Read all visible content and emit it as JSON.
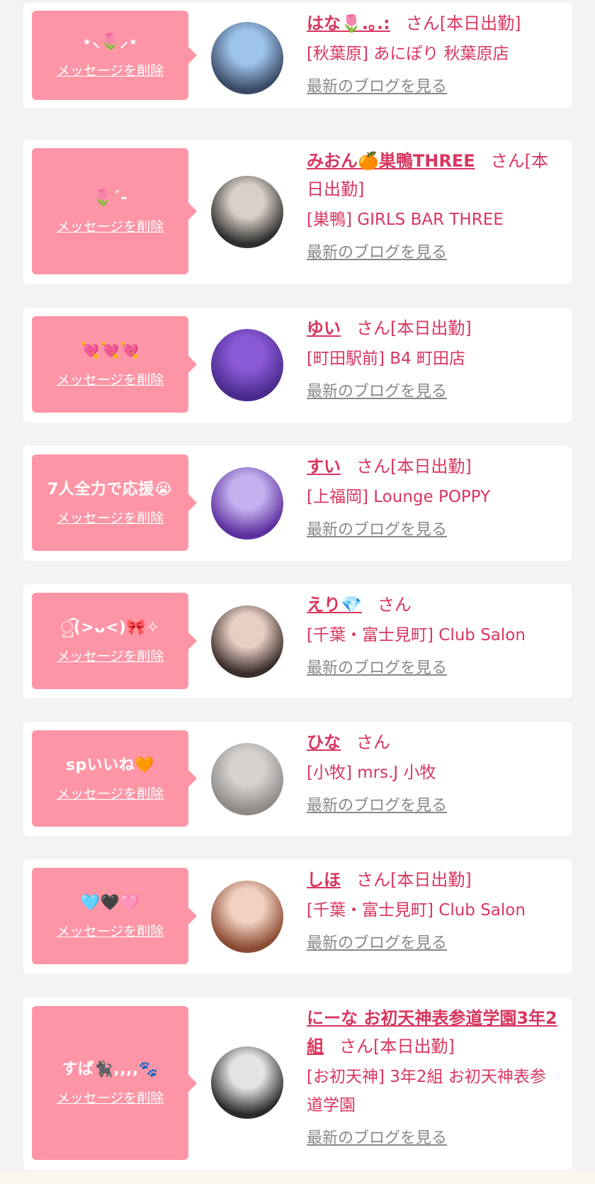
{
  "delete_label": "メッセージを削除",
  "blog_label": "最新のブログを見る",
  "san": "さん",
  "cards": [
    {
      "message": "⋆⸜🌷⸝⋆",
      "name": "はな🌷.｡.:",
      "status": "[本日出勤]",
      "shop": "[秋葉原] あにぽり 秋葉原店",
      "avatar_colors": [
        "#3a4a66",
        "#9ec4ec"
      ]
    },
    {
      "message": "🌷´-",
      "name": "みおん🍊巣鴨THREE",
      "status": "[本日出勤]",
      "shop": "[巣鴨] GIRLS BAR THREE",
      "avatar_colors": [
        "#2e2e2e",
        "#d9d1c7"
      ]
    },
    {
      "message": "💘💘💘",
      "name": "ゆい",
      "status": "[本日出勤]",
      "shop": "[町田駅前] B4 町田店",
      "avatar_colors": [
        "#4a2a8c",
        "#8a5ad6"
      ]
    },
    {
      "message": "7人全力で応援😭",
      "name": "すい",
      "status": "[本日出勤]",
      "shop": "[上福岡] Lounge POPPY",
      "avatar_colors": [
        "#5d2f9e",
        "#c4b2ef"
      ]
    },
    {
      "message": "ු͡(>ᴗ<)🎀✧",
      "name": "えり💎",
      "status": "",
      "shop": "[千葉・富士見町] Club Salon",
      "avatar_colors": [
        "#3a2d2a",
        "#e8cfc4"
      ]
    },
    {
      "message": "spいいね🧡",
      "name": "ひな",
      "status": "",
      "shop": "[小牧] mrs.J 小牧",
      "avatar_colors": [
        "#8f8a86",
        "#d6d3d1"
      ]
    },
    {
      "message": "🩵🖤🩷",
      "name": "しほ",
      "status": "[本日出勤]",
      "shop": "[千葉・富士見町] Club Salon",
      "avatar_colors": [
        "#8b4a33",
        "#f2d1c2"
      ]
    },
    {
      "message": "すぱ🐈‍⬛,,,,🐾",
      "name": "にーな お初天神表参道学園3年2組",
      "status": "[本日出勤]",
      "shop": "[お初天神] 3年2組 お初天神表参道学園",
      "avatar_colors": [
        "#2a2a2a",
        "#e4e4e4"
      ]
    }
  ]
}
